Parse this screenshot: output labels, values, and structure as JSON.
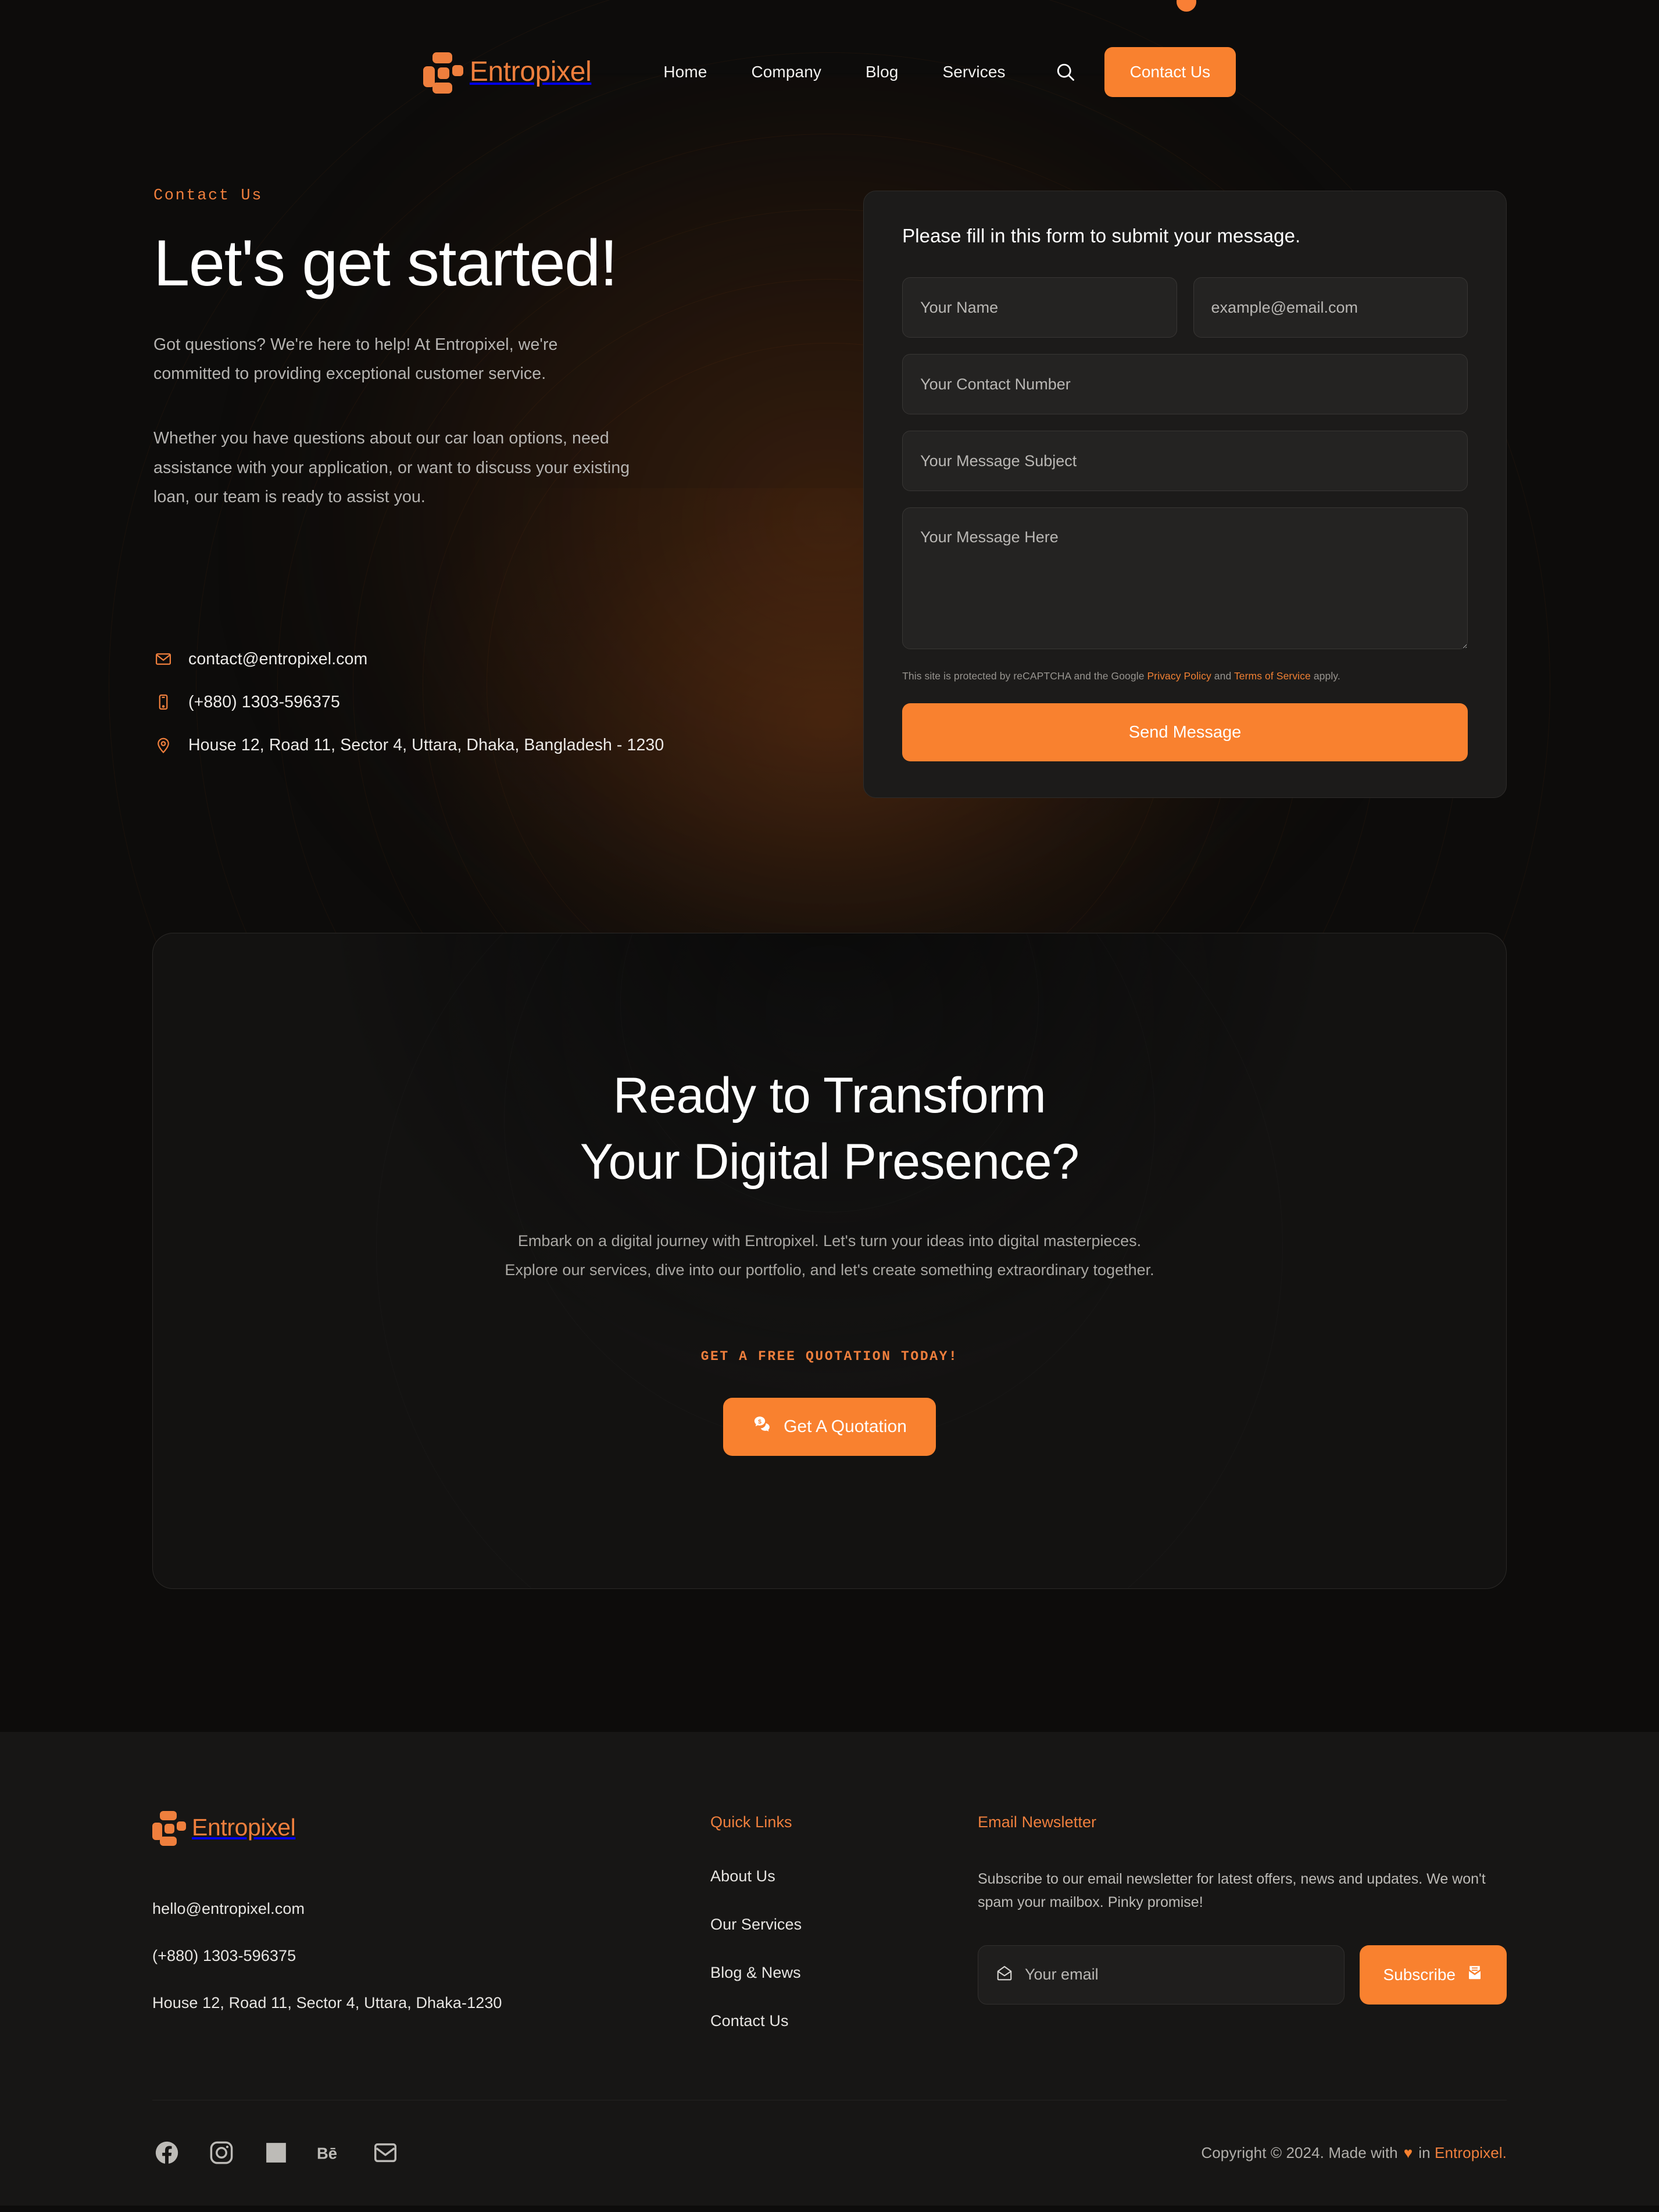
{
  "theme": {
    "accent": "#f9812f",
    "accent_text": "#ef7f3d",
    "page_bg": "#0d0c0b",
    "card_bg": "#1c1b1a",
    "footer_bg": "#171615"
  },
  "header": {
    "logo_text": "Entropixel",
    "nav": [
      {
        "label": "Home"
      },
      {
        "label": "Company"
      },
      {
        "label": "Blog"
      },
      {
        "label": "Services"
      }
    ],
    "search_icon": "search-icon",
    "cta_label": "Contact Us"
  },
  "hero": {
    "eyebrow": "Contact Us",
    "title": "Let's get started!",
    "paragraph_1": "Got questions? We're here to help! At Entropixel, we're committed to providing exceptional customer service.",
    "paragraph_2": "Whether you have questions about our car loan options, need assistance with your application, or want to discuss your existing loan, our team is ready to assist you.",
    "contacts": [
      {
        "icon": "envelope-icon",
        "value": "contact@entropixel.com"
      },
      {
        "icon": "phone-icon",
        "value": "(+880) 1303-596375"
      },
      {
        "icon": "location-pin-icon",
        "value": "House 12, Road 11, Sector 4, Uttara, Dhaka, Bangladesh - 1230"
      }
    ]
  },
  "form": {
    "heading": "Please fill in this form to submit your message.",
    "name_placeholder": "Your Name",
    "email_placeholder": "example@email.com",
    "phone_placeholder": "Your Contact Number",
    "subject_placeholder": "Your Message Subject",
    "message_placeholder": "Your Message Here",
    "name_value": "",
    "email_value": "",
    "phone_value": "",
    "subject_value": "",
    "message_value": "",
    "recaptcha_prefix": "This site is protected by reCAPTCHA and the Google ",
    "recaptcha_link_1": "Privacy Policy",
    "recaptcha_mid": " and ",
    "recaptcha_link_2": "Terms of Service",
    "recaptcha_suffix": " apply.",
    "submit_label": "Send Message"
  },
  "cta": {
    "title_line_1": "Ready to Transform",
    "title_line_2": "Your Digital Presence?",
    "subtitle": "Embark on a digital journey with Entropixel. Let's turn your ideas into digital masterpieces. Explore our services, dive into our portfolio, and let's create something extraordinary together.",
    "kicker": "GET A FREE QUOTATION TODAY!",
    "button_label": "Get A Quotation",
    "button_icon": "chat-dollar-icon"
  },
  "footer": {
    "logo_text": "Entropixel",
    "email": "hello@entropixel.com",
    "phone": "(+880) 1303-596375",
    "address": "House 12, Road 11, Sector 4, Uttara, Dhaka-1230",
    "quick_links_heading": "Quick Links",
    "quick_links": [
      {
        "label": "About Us"
      },
      {
        "label": "Our Services"
      },
      {
        "label": "Blog & News"
      },
      {
        "label": "Contact Us"
      }
    ],
    "newsletter_heading": "Email Newsletter",
    "newsletter_text": "Subscribe to our email newsletter for latest offers, news and updates. We won't spam your mailbox. Pinky promise!",
    "newsletter_placeholder": "Your email",
    "newsletter_value": "",
    "newsletter_icon": "envelope-open-icon",
    "subscribe_label": "Subscribe",
    "subscribe_icon": "mail-send-icon",
    "socials": [
      {
        "name": "facebook-icon"
      },
      {
        "name": "instagram-icon"
      },
      {
        "name": "linkedin-icon"
      },
      {
        "name": "behance-icon"
      },
      {
        "name": "email-icon"
      }
    ],
    "copyright_prefix": "Copyright © 2024. Made with",
    "copyright_heart": "♥",
    "copyright_mid": "in",
    "copyright_brand": "Entropixel."
  }
}
